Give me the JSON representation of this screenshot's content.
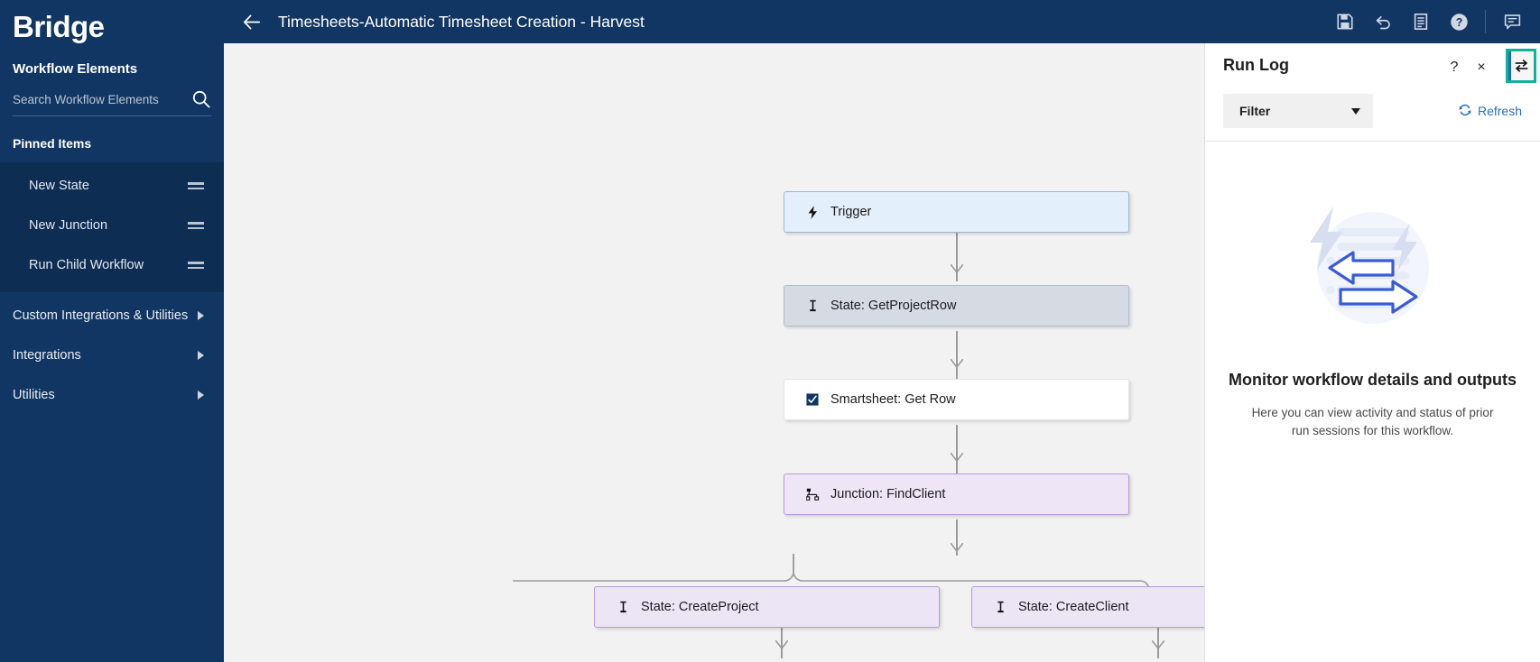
{
  "brand": {
    "name": "Bridge"
  },
  "sidebar": {
    "section_title": "Workflow Elements",
    "search": {
      "placeholder": "Search Workflow Elements",
      "value": "",
      "icon": "search-icon"
    },
    "pinned_label": "Pinned Items",
    "pinned_items": [
      {
        "label": "New State",
        "icon": "drag-handle-icon"
      },
      {
        "label": "New Junction",
        "icon": "drag-handle-icon"
      },
      {
        "label": "Run Child Workflow",
        "icon": "drag-handle-icon"
      }
    ],
    "nav_items": [
      {
        "label": "Custom Integrations & Utilities",
        "icon": "chevron-right-icon"
      },
      {
        "label": "Integrations",
        "icon": "chevron-right-icon"
      },
      {
        "label": "Utilities",
        "icon": "chevron-right-icon"
      }
    ]
  },
  "header": {
    "back_icon": "arrow-left-icon",
    "title": "Timesheets-Automatic Timesheet Creation - Harvest",
    "icons": [
      {
        "name": "save-icon",
        "label": "Save"
      },
      {
        "name": "undo-icon",
        "label": "Undo"
      },
      {
        "name": "document-icon",
        "label": "Documentation"
      },
      {
        "name": "help-icon",
        "label": "Help"
      },
      {
        "name": "comments-icon",
        "label": "Comments"
      }
    ]
  },
  "canvas": {
    "nodes": [
      {
        "id": "trigger",
        "label": "Trigger",
        "icon": "lightning-icon",
        "type": "trigger"
      },
      {
        "id": "getprojectrow",
        "label": "State: GetProjectRow",
        "icon": "state-pin-icon",
        "type": "state"
      },
      {
        "id": "getrow",
        "label": "Smartsheet: Get Row",
        "icon": "smartsheet-icon",
        "type": "card"
      },
      {
        "id": "findclient",
        "label": "Junction: FindClient",
        "icon": "junction-icon",
        "type": "junction"
      },
      {
        "id": "createproject",
        "label": "State: CreateProject",
        "icon": "state-pin-icon",
        "type": "purple"
      },
      {
        "id": "createclient",
        "label": "State: CreateClient",
        "icon": "state-pin-icon",
        "type": "purple"
      }
    ]
  },
  "run_log": {
    "title": "Run Log",
    "help_label": "?",
    "close_label": "×",
    "swap_icon": "swap-arrows-icon",
    "filter": {
      "label": "Filter",
      "icon": "chevron-down-icon"
    },
    "refresh": {
      "label": "Refresh",
      "icon": "refresh-icon"
    },
    "empty": {
      "illustration": "run-log-empty-illustration",
      "title": "Monitor workflow details and outputs",
      "subtitle": "Here you can view activity and status of prior run sessions for this workflow."
    }
  },
  "colors": {
    "brand_navy": "#123663",
    "sidebar_pinned_bg": "#0e2d53",
    "canvas_bg": "#f2f2f2",
    "trigger_bg": "#e4effc",
    "state_bg": "#d6dbe3",
    "junction_bg": "#eee6f7",
    "accent_link": "#2a6ec4",
    "highlight_teal": "#11b398"
  }
}
